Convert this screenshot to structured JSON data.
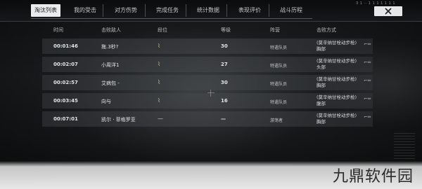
{
  "tabs": [
    {
      "label": "淘汰列表",
      "active": true
    },
    {
      "label": "我的受击",
      "active": false
    },
    {
      "label": "对方伤势",
      "active": false
    },
    {
      "label": "完成任务",
      "active": false
    },
    {
      "label": "统计数据",
      "active": false
    },
    {
      "label": "表现评价",
      "active": false
    },
    {
      "label": "战斗历程",
      "active": false
    }
  ],
  "status_text": "3 1 ·· 1 1 1 1 1 1 1",
  "table": {
    "headers": [
      "时间",
      "击败敌人",
      "段位",
      "等级",
      "阵营",
      "击败方式"
    ],
    "rows": [
      {
        "time": "00:01:46",
        "enemy": "拖.3秒?",
        "rank": "⌇",
        "level": "30",
        "camp": "特遣队员",
        "method_line1": "(莫辛纳甘栓动步枪)",
        "method_line2": "胸部"
      },
      {
        "time": "00:02:07",
        "enemy": "小周洋1",
        "rank": "⌇",
        "level": "27",
        "camp": "特遣队员",
        "method_line1": "(莫辛纳甘栓动步枪)",
        "method_line2": "头部"
      },
      {
        "time": "00:02:57",
        "enemy": "艾病包 -",
        "rank": "⌇",
        "level": "30",
        "camp": "特遣队员",
        "method_line1": "(莫辛纳甘栓动步枪)",
        "method_line2": "胸部"
      },
      {
        "time": "00:03:45",
        "enemy": "向与",
        "rank": "⌇",
        "level": "16",
        "camp": "特遣队员",
        "method_line1": "(莫辛纳甘栓动步枪)",
        "method_line2": "腹部"
      },
      {
        "time": "00:07:01",
        "enemy": "凯尔 · 菲格罗亚",
        "rank": "—",
        "level": "—",
        "camp": "游荡者",
        "method_line1": "(莫辛纳甘栓动步枪)",
        "method_line2": "胸部"
      }
    ]
  },
  "watermark": "九鼎软件园",
  "icons": {
    "close": "close-x-icon",
    "weapon": "weapon-icon",
    "rank": "rank-badge-icon"
  }
}
